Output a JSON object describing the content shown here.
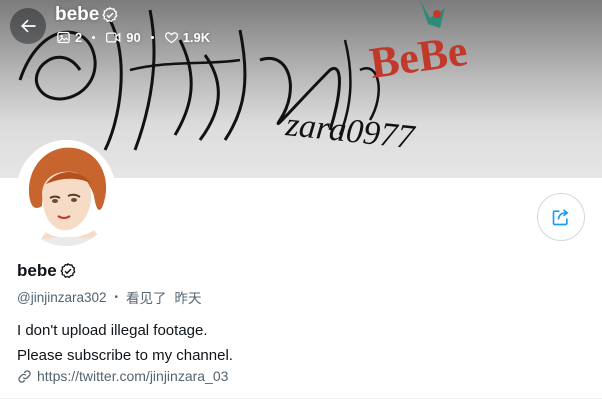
{
  "header": {
    "display_name": "bebe",
    "stats": {
      "photos": "2",
      "videos": "90",
      "likes": "1.9K"
    }
  },
  "banner": {
    "script_text": "@Jhyhm",
    "brand_text": "BeBe",
    "sub_text": "zara0977"
  },
  "profile": {
    "display_name": "bebe",
    "handle": "@jinjinzara302",
    "separator": "•",
    "seen_label": "看见了",
    "seen_time": "昨天",
    "bio_line1": "I don't upload illegal footage.",
    "bio_line2": "Please subscribe to my channel.",
    "link": "https://twitter.com/jinjinzara_03"
  },
  "icons": {
    "back": "arrow-left-icon",
    "verified": "verified-badge-icon",
    "photo": "image-icon",
    "video": "video-camera-icon",
    "like": "heart-icon",
    "share": "share-icon",
    "link": "link-icon"
  },
  "colors": {
    "text_primary": "#0f1419",
    "text_secondary": "#536471",
    "accent": "#1d9bf0",
    "banner_red": "#c0392b"
  }
}
